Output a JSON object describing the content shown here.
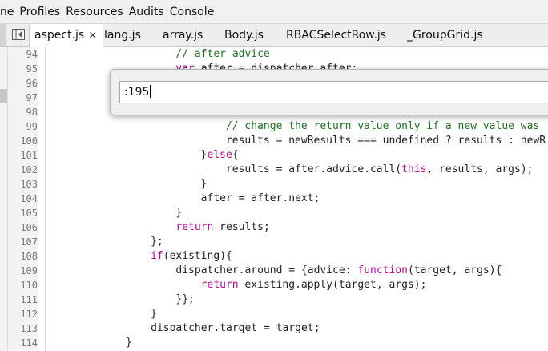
{
  "menu": [
    "ine",
    "Profiles",
    "Resources",
    "Audits",
    "Console"
  ],
  "tabs": [
    {
      "label": "aspect.js",
      "close": "×",
      "active": true
    },
    {
      "label": "lang.js"
    },
    {
      "label": "array.js"
    },
    {
      "label": "Body.js"
    },
    {
      "label": "RBACSelectRow.js"
    },
    {
      "label": "_GroupGrid.js"
    }
  ],
  "goto": {
    "value": ":195"
  },
  "lines": [
    {
      "n": "94",
      "code": "// after advice",
      "cls": "c-comment",
      "indent": 20
    },
    {
      "n": "95",
      "code": "var after = dispatcher.after;",
      "cls": "",
      "indent": 20
    },
    {
      "n": "96",
      "code": "",
      "cls": "",
      "indent": 0
    },
    {
      "n": "97",
      "code": "",
      "cls": "",
      "indent": 0
    },
    {
      "n": "98",
      "code": "",
      "cls": "",
      "indent": 0
    },
    {
      "n": "99",
      "code": "// change the return value only if a new value was",
      "cls": "c-comment",
      "indent": 28
    },
    {
      "n": "100",
      "code": "results = newResults === undefined ? results : newR",
      "cls": "",
      "indent": 28
    },
    {
      "n": "101",
      "code": "}else{",
      "cls": "",
      "indent": 24
    },
    {
      "n": "102",
      "code": "results = after.advice.call(this, results, args);",
      "cls": "",
      "indent": 28
    },
    {
      "n": "103",
      "code": "}",
      "cls": "",
      "indent": 24
    },
    {
      "n": "104",
      "code": "after = after.next;",
      "cls": "",
      "indent": 24
    },
    {
      "n": "105",
      "code": "}",
      "cls": "",
      "indent": 20
    },
    {
      "n": "106",
      "code": "return results;",
      "cls": "",
      "indent": 20
    },
    {
      "n": "107",
      "code": "};",
      "cls": "",
      "indent": 16
    },
    {
      "n": "108",
      "code": "if(existing){",
      "cls": "",
      "indent": 16
    },
    {
      "n": "109",
      "code": "dispatcher.around = {advice: function(target, args){",
      "cls": "",
      "indent": 20
    },
    {
      "n": "110",
      "code": "return existing.apply(target, args);",
      "cls": "",
      "indent": 24
    },
    {
      "n": "111",
      "code": "}};",
      "cls": "",
      "indent": 20
    },
    {
      "n": "112",
      "code": "}",
      "cls": "",
      "indent": 16
    },
    {
      "n": "113",
      "code": "dispatcher.target = target;",
      "cls": "",
      "indent": 16
    },
    {
      "n": "114",
      "code": "}",
      "cls": "",
      "indent": 12
    }
  ]
}
